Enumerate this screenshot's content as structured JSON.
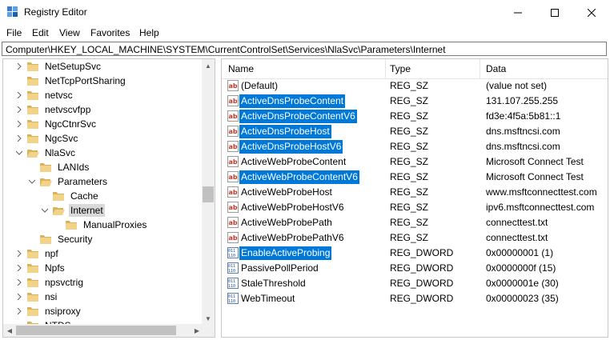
{
  "window": {
    "title": "Registry Editor"
  },
  "menu": [
    "File",
    "Edit",
    "View",
    "Favorites",
    "Help"
  ],
  "address": "Computer\\HKEY_LOCAL_MACHINE\\SYSTEM\\CurrentControlSet\\Services\\NlaSvc\\Parameters\\Internet",
  "tree": [
    {
      "label": "NetSetupSvc",
      "expander": ">"
    },
    {
      "label": "NetTcpPortSharing",
      "expander": ""
    },
    {
      "label": "netvsc",
      "expander": ">"
    },
    {
      "label": "netvscvfpp",
      "expander": ">"
    },
    {
      "label": "NgcCtnrSvc",
      "expander": ">"
    },
    {
      "label": "NgcSvc",
      "expander": ">"
    },
    {
      "label": "NlaSvc",
      "expander": "v"
    },
    {
      "label": "LANIds",
      "expander": ""
    },
    {
      "label": "Parameters",
      "expander": "v"
    },
    {
      "label": "Cache",
      "expander": ""
    },
    {
      "label": "Internet",
      "expander": "v"
    },
    {
      "label": "ManualProxies",
      "expander": ""
    },
    {
      "label": "Security",
      "expander": ""
    },
    {
      "label": "npf",
      "expander": ">"
    },
    {
      "label": "Npfs",
      "expander": ">"
    },
    {
      "label": "npsvctrig",
      "expander": ">"
    },
    {
      "label": "nsi",
      "expander": ">"
    },
    {
      "label": "nsiproxy",
      "expander": ">"
    },
    {
      "label": "NTDS",
      "expander": ""
    }
  ],
  "columns": {
    "name": "Name",
    "type": "Type",
    "data": "Data"
  },
  "values": [
    {
      "name": "(Default)",
      "type": "REG_SZ",
      "data": "(value not set)",
      "icon": "string-value-icon"
    },
    {
      "name": "ActiveDnsProbeContent",
      "type": "REG_SZ",
      "data": "131.107.255.255",
      "icon": "string-value-icon"
    },
    {
      "name": "ActiveDnsProbeContentV6",
      "type": "REG_SZ",
      "data": "fd3e:4f5a:5b81::1",
      "icon": "string-value-icon"
    },
    {
      "name": "ActiveDnsProbeHost",
      "type": "REG_SZ",
      "data": "dns.msftncsi.com",
      "icon": "string-value-icon"
    },
    {
      "name": "ActiveDnsProbeHostV6",
      "type": "REG_SZ",
      "data": "dns.msftncsi.com",
      "icon": "string-value-icon"
    },
    {
      "name": "ActiveWebProbeContent",
      "type": "REG_SZ",
      "data": "Microsoft Connect Test",
      "icon": "string-value-icon"
    },
    {
      "name": "ActiveWebProbeContentV6",
      "type": "REG_SZ",
      "data": "Microsoft Connect Test",
      "icon": "string-value-icon"
    },
    {
      "name": "ActiveWebProbeHost",
      "type": "REG_SZ",
      "data": "www.msftconnecttest.com",
      "icon": "string-value-icon"
    },
    {
      "name": "ActiveWebProbeHostV6",
      "type": "REG_SZ",
      "data": "ipv6.msftconnecttest.com",
      "icon": "string-value-icon"
    },
    {
      "name": "ActiveWebProbePath",
      "type": "REG_SZ",
      "data": "connecttest.txt",
      "icon": "string-value-icon"
    },
    {
      "name": "ActiveWebProbePathV6",
      "type": "REG_SZ",
      "data": "connecttest.txt",
      "icon": "string-value-icon"
    },
    {
      "name": "EnableActiveProbing",
      "type": "REG_DWORD",
      "data": "0x00000001 (1)",
      "icon": "binary-value-icon"
    },
    {
      "name": "PassivePollPeriod",
      "type": "REG_DWORD",
      "data": "0x0000000f (15)",
      "icon": "binary-value-icon"
    },
    {
      "name": "StaleThreshold",
      "type": "REG_DWORD",
      "data": "0x0000001e (30)",
      "icon": "binary-value-icon"
    },
    {
      "name": "WebTimeout",
      "type": "REG_DWORD",
      "data": "0x00000023 (35)",
      "icon": "binary-value-icon"
    }
  ],
  "colors": {
    "highlight": "#0078d7",
    "folder": "#dcb35c",
    "tree_selected": "#d9d9d9"
  }
}
